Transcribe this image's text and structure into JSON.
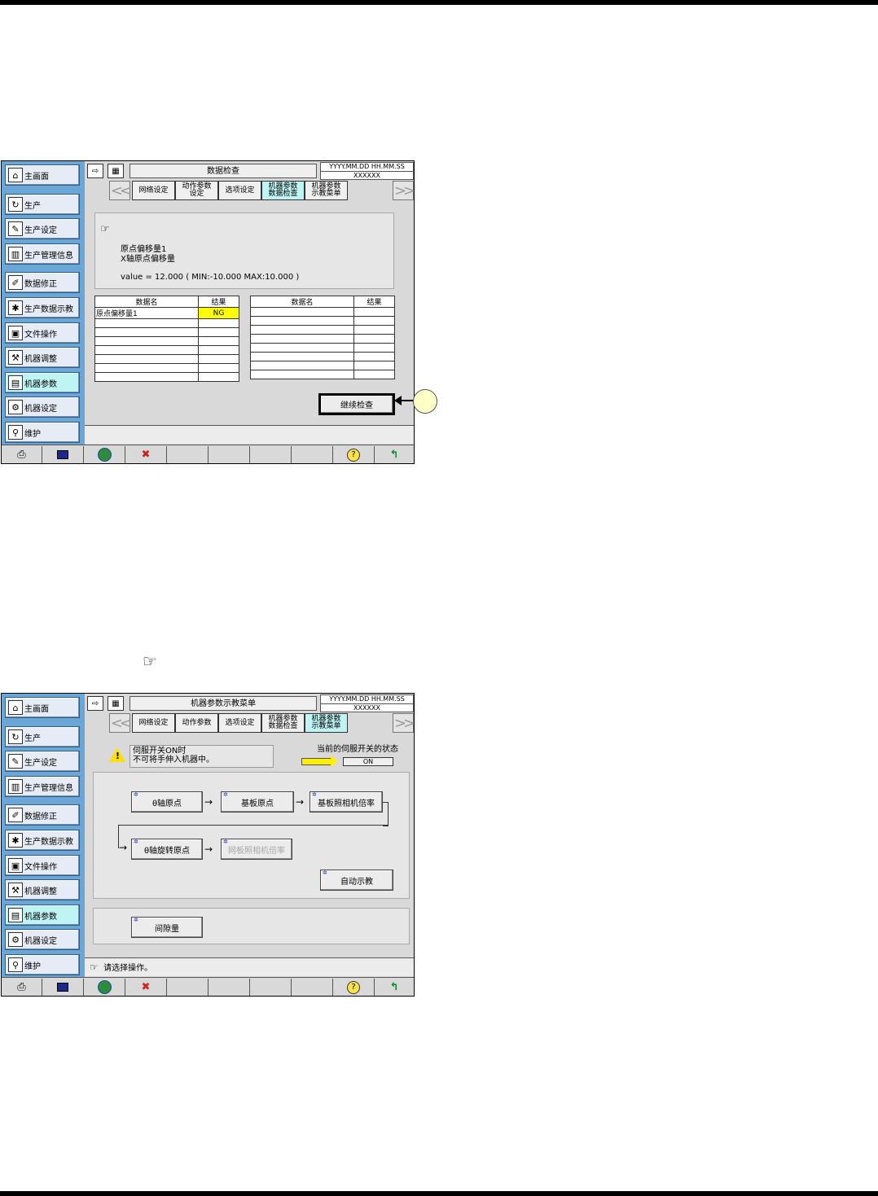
{
  "screen1": {
    "title": "数据检查",
    "date": "YYYY.MM.DD HH.MM.SS",
    "code": "XXXXXX",
    "tabs": [
      {
        "line1": "网络设定",
        "line2": ""
      },
      {
        "line1": "动作参数",
        "line2": "设定"
      },
      {
        "line1": "选项设定",
        "line2": ""
      },
      {
        "line1": "机器参数",
        "line2": "数据检查"
      },
      {
        "line1": "机器参数",
        "line2": "示教菜单"
      }
    ],
    "message": {
      "line1": "原点偏移量1",
      "line2": "X轴原点偏移量",
      "line3": "value = 12.000 ( MIN:-10.000  MAX:10.000 )"
    },
    "table": {
      "header_name": "数据名",
      "header_result": "结果",
      "rows": [
        {
          "name": "原点偏移量1",
          "result": "NG"
        }
      ]
    },
    "continue_button": "继续检查"
  },
  "screen2": {
    "title": "机器参数示教菜单",
    "date": "YYYY.MM.DD HH.MM.SS",
    "code": "XXXXXX",
    "tabs": [
      {
        "line1": "网络设定",
        "line2": ""
      },
      {
        "line1": "动作参数",
        "line2": ""
      },
      {
        "line1": "选项设定",
        "line2": ""
      },
      {
        "line1": "机器参数",
        "line2": "数据检查"
      },
      {
        "line1": "机器参数",
        "line2": "示教菜单"
      }
    ],
    "warning": {
      "line1": "伺服开关ON时",
      "line2": "不可将手伸入机器中。"
    },
    "servo_state_label": "当前的伺服开关的状态",
    "servo_state_value": "ON",
    "flow": {
      "step1": "θ轴原点",
      "step2": "基板原点",
      "step3": "基板照相机倍率",
      "step4": "θ轴旋转原点",
      "step5": "网板照相机倍率",
      "auto": "自动示教"
    },
    "gap_button": "间隙量",
    "status": "请选择操作。"
  },
  "sidebar": [
    "主画面",
    "生产",
    "生产设定",
    "生产管理信息",
    "数据修正",
    "生产数据示教",
    "文件操作",
    "机器调整",
    "机器参数",
    "机器设定",
    "维护"
  ]
}
